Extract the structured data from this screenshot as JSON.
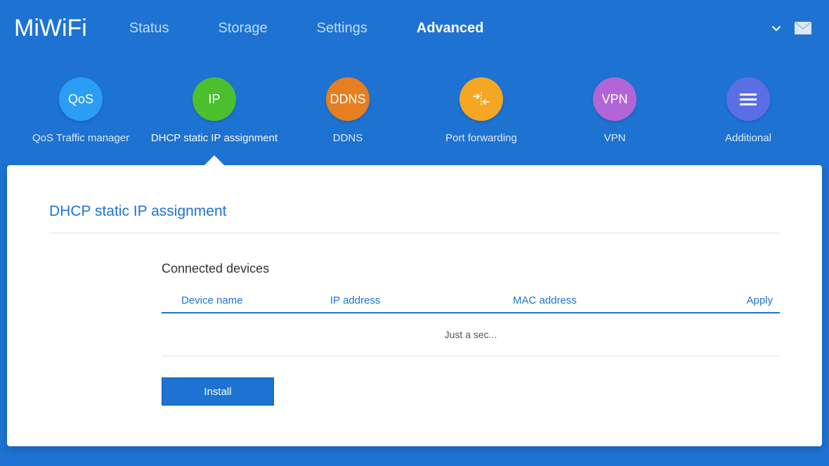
{
  "logo": "MiWiFi",
  "nav": {
    "items": [
      "Status",
      "Storage",
      "Settings",
      "Advanced"
    ],
    "active_index": 3
  },
  "subnav": {
    "items": [
      {
        "label": "QoS Traffic manager",
        "badge": "QoS",
        "color": "blue"
      },
      {
        "label": "DHCP static IP assignment",
        "badge": "IP",
        "color": "green"
      },
      {
        "label": "DDNS",
        "badge": "DDNS",
        "color": "orange"
      },
      {
        "label": "Port forwarding",
        "badge": "",
        "color": "yellow"
      },
      {
        "label": "VPN",
        "badge": "VPN",
        "color": "purple"
      },
      {
        "label": "Additional",
        "badge": "",
        "color": "indigo"
      }
    ],
    "active_index": 1
  },
  "panel": {
    "title": "DHCP static IP assignment",
    "section_title": "Connected devices",
    "columns": {
      "device_name": "Device name",
      "ip_address": "IP address",
      "mac_address": "MAC address",
      "apply": "Apply"
    },
    "loading_text": "Just a sec...",
    "install_button": "Install"
  }
}
